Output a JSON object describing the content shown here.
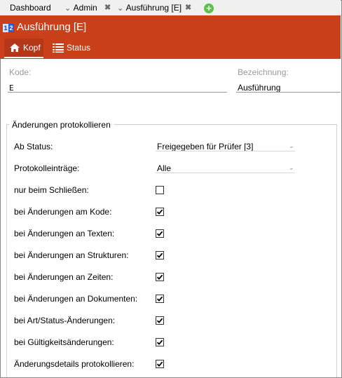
{
  "tabs": [
    {
      "label": "Dashboard"
    },
    {
      "label": "Admin"
    },
    {
      "label": "Ausführung [E]"
    }
  ],
  "header": {
    "title": "Ausführung [E]",
    "icon_text_a": "1",
    "icon_text_b": "2",
    "subtabs": [
      {
        "label": "Kopf",
        "icon": "home-icon",
        "active": true
      },
      {
        "label": "Status",
        "icon": "list-icon",
        "active": false
      }
    ],
    "color": "#c9401a"
  },
  "form": {
    "kode_label": "Kode:",
    "kode_value": "E",
    "bezeichnung_label": "Bezeichnung:",
    "bezeichnung_value": "Ausführung"
  },
  "group": {
    "legend": "Änderungen protokollieren",
    "ab_status_label": "Ab Status:",
    "ab_status_value": "Freigegeben für Prüfer [3]",
    "protokoll_label": "Protokolleinträge:",
    "protokoll_value": "Alle",
    "checkboxes": [
      {
        "label": "nur beim Schließen:",
        "checked": false
      },
      {
        "label": "bei Änderungen am Kode:",
        "checked": true
      },
      {
        "label": "bei Änderungen an Texten:",
        "checked": true
      },
      {
        "label": "bei Änderungen an Strukturen:",
        "checked": true
      },
      {
        "label": "bei Änderungen an Zeiten:",
        "checked": true
      },
      {
        "label": "bei Änderungen an Dokumenten:",
        "checked": true
      },
      {
        "label": "bei Art/Status-Änderungen:",
        "checked": true
      },
      {
        "label": "bei Gültigkeitsänderungen:",
        "checked": true
      },
      {
        "label": "Änderungsdetails protokollieren:",
        "checked": true
      }
    ]
  }
}
